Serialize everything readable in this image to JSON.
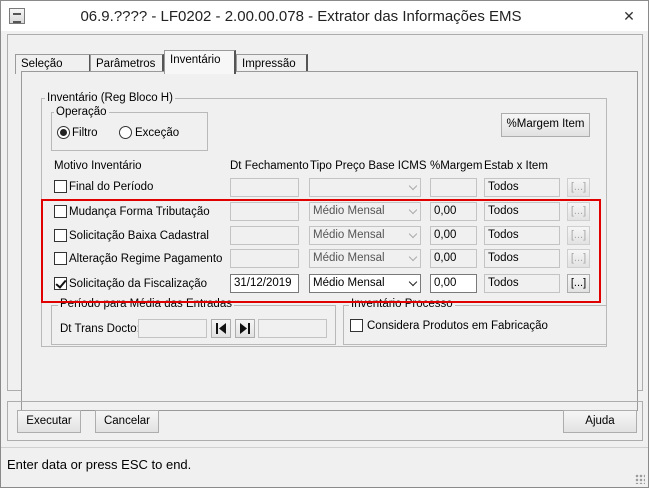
{
  "window": {
    "title": "06.9.???? - LF0202 - 2.00.00.078 - Extrator das Informações EMS",
    "close_glyph": "✕"
  },
  "tabs": [
    "Seleção",
    "Parâmetros",
    "Inventário",
    "Impressão"
  ],
  "inventario": {
    "group_title": "Inventário (Reg Bloco H)",
    "operacao": {
      "title": "Operação",
      "options": [
        "Filtro",
        "Exceção"
      ],
      "selected": "Filtro"
    },
    "margem_button": "%Margem Item",
    "headers": {
      "motivo": "Motivo Inventário",
      "dt_fechamento": "Dt Fechamento",
      "tipo_preco": "Tipo Preço Base ICMS",
      "margem": "%Margem",
      "estab": "Estab x Item"
    },
    "rows": [
      {
        "label": "Final do Período",
        "checked": false,
        "dt": "",
        "tipo": "",
        "margem": "",
        "estab": "Todos",
        "btn": "[...]"
      },
      {
        "label": "Mudança Forma Tributação",
        "checked": false,
        "dt": "",
        "tipo": "Médio Mensal",
        "margem": "0,00",
        "estab": "Todos",
        "btn": "[...]"
      },
      {
        "label": "Solicitação Baixa Cadastral",
        "checked": false,
        "dt": "",
        "tipo": "Médio Mensal",
        "margem": "0,00",
        "estab": "Todos",
        "btn": "[...]"
      },
      {
        "label": "Alteração Regime Pagamento",
        "checked": false,
        "dt": "",
        "tipo": "Médio Mensal",
        "margem": "0,00",
        "estab": "Todos",
        "btn": "[...]"
      },
      {
        "label": "Solicitação da Fiscalização",
        "checked": true,
        "dt": "31/12/2019",
        "tipo": "Médio Mensal",
        "margem": "0,00",
        "estab": "Todos",
        "btn": "[...]"
      }
    ],
    "periodo": {
      "title": "Período para Média das Entradas",
      "dt_label": "Dt Trans Docto:",
      "from": "",
      "to": ""
    },
    "processo": {
      "title": "Inventário Processo",
      "checkbox_label": "Considera Produtos em Fabricação",
      "checked": false
    }
  },
  "buttons": {
    "executar": "Executar",
    "cancelar": "Cancelar",
    "ajuda": "Ajuda"
  },
  "status": {
    "text": "Enter data or press ESC to end."
  },
  "colors": {
    "highlight": "#e00000"
  }
}
